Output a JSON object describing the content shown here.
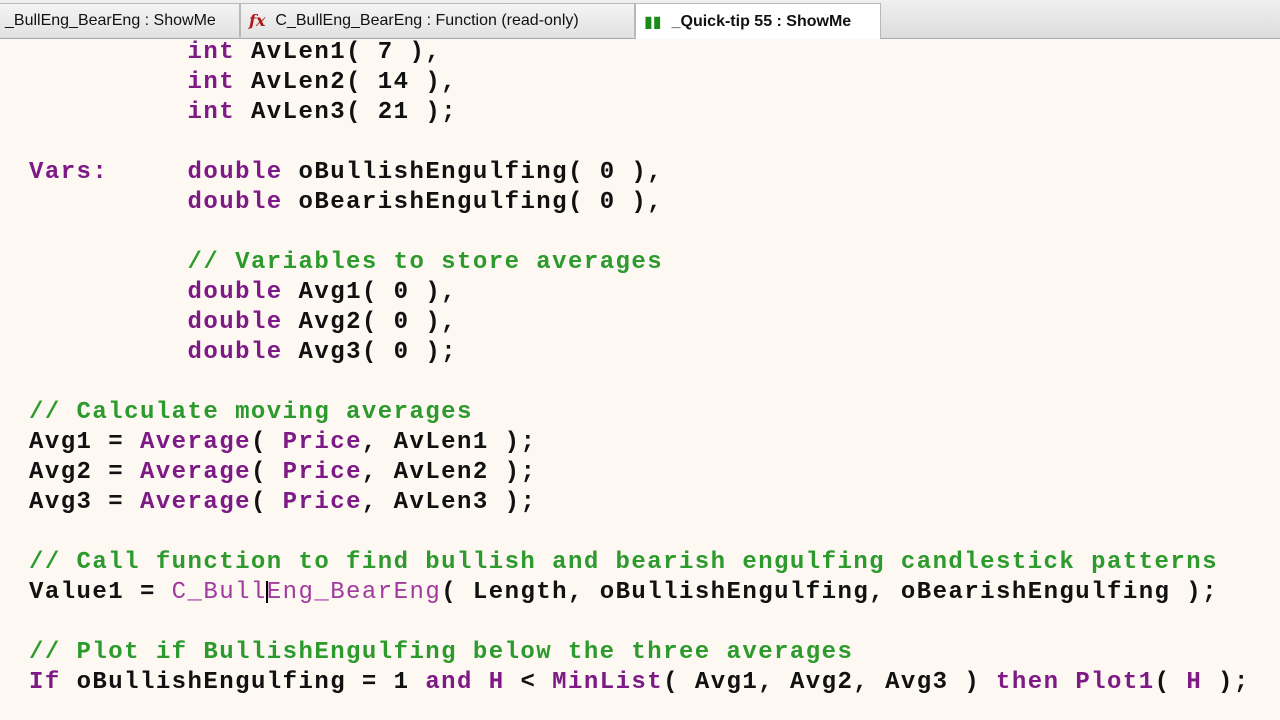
{
  "tabs": [
    {
      "label": "_BullEng_BearEng : ShowMe",
      "icon": "none",
      "active": false
    },
    {
      "label": "C_BullEng_BearEng : Function (read-only)",
      "icon": "function-fx-icon",
      "active": false
    },
    {
      "label": "_Quick-tip 55 : ShowMe",
      "icon": "showme-chart-icon",
      "active": true
    }
  ],
  "colors": {
    "keyword": "#7d1a86",
    "function": "#a03a9e",
    "comment": "#2c9a2c",
    "text": "#111111",
    "background": "#fdf8f2"
  },
  "code": [
    [
      [
        "t",
        "          "
      ],
      [
        "kw",
        "int"
      ],
      [
        "t",
        " AvLen1( 7 ),"
      ]
    ],
    [
      [
        "t",
        "          "
      ],
      [
        "kw",
        "int"
      ],
      [
        "t",
        " AvLen2( 14 ),"
      ]
    ],
    [
      [
        "t",
        "          "
      ],
      [
        "kw",
        "int"
      ],
      [
        "t",
        " AvLen3( 21 );"
      ]
    ],
    [],
    [
      [
        "kw",
        "Vars:"
      ],
      [
        "t",
        "     "
      ],
      [
        "kw",
        "double"
      ],
      [
        "t",
        " oBullishEngulfing( 0 ),"
      ]
    ],
    [
      [
        "t",
        "          "
      ],
      [
        "kw",
        "double"
      ],
      [
        "t",
        " oBearishEngulfing( 0 ),"
      ]
    ],
    [],
    [
      [
        "t",
        "          "
      ],
      [
        "cm",
        "// Variables to store averages"
      ]
    ],
    [
      [
        "t",
        "          "
      ],
      [
        "kw",
        "double"
      ],
      [
        "t",
        " Avg1( 0 ),"
      ]
    ],
    [
      [
        "t",
        "          "
      ],
      [
        "kw",
        "double"
      ],
      [
        "t",
        " Avg2( 0 ),"
      ]
    ],
    [
      [
        "t",
        "          "
      ],
      [
        "kw",
        "double"
      ],
      [
        "t",
        " Avg3( 0 );"
      ]
    ],
    [],
    [
      [
        "cm",
        "// Calculate moving averages"
      ]
    ],
    [
      [
        "t",
        "Avg1 = "
      ],
      [
        "kw",
        "Average"
      ],
      [
        "t",
        "( "
      ],
      [
        "kw",
        "Price"
      ],
      [
        "t",
        ", AvLen1 );"
      ]
    ],
    [
      [
        "t",
        "Avg2 = "
      ],
      [
        "kw",
        "Average"
      ],
      [
        "t",
        "( "
      ],
      [
        "kw",
        "Price"
      ],
      [
        "t",
        ", AvLen2 );"
      ]
    ],
    [
      [
        "t",
        "Avg3 = "
      ],
      [
        "kw",
        "Average"
      ],
      [
        "t",
        "( "
      ],
      [
        "kw",
        "Price"
      ],
      [
        "t",
        ", AvLen3 );"
      ]
    ],
    [],
    [
      [
        "cm",
        "// Call function to find bullish and bearish engulfing candlestick patterns"
      ]
    ],
    [
      [
        "t",
        "Value1 = "
      ],
      [
        "fn",
        "C_BullEng_BearEng"
      ],
      [
        "t",
        "( Length, oBullishEngulfing, oBearishEngulfing );"
      ]
    ],
    [],
    [
      [
        "cm",
        "// Plot if BullishEngulfing below the three averages"
      ]
    ],
    [
      [
        "kw",
        "If"
      ],
      [
        "t",
        " oBullishEngulfing = 1 "
      ],
      [
        "kw",
        "and"
      ],
      [
        "t",
        " "
      ],
      [
        "kw",
        "H"
      ],
      [
        "t",
        " < "
      ],
      [
        "kw",
        "MinList"
      ],
      [
        "t",
        "( Avg1, Avg2, Avg3 ) "
      ],
      [
        "kw",
        "then"
      ],
      [
        "t",
        " "
      ],
      [
        "kw",
        "Plot1"
      ],
      [
        "t",
        "( "
      ],
      [
        "kw",
        "H"
      ],
      [
        "t",
        " );"
      ]
    ]
  ]
}
